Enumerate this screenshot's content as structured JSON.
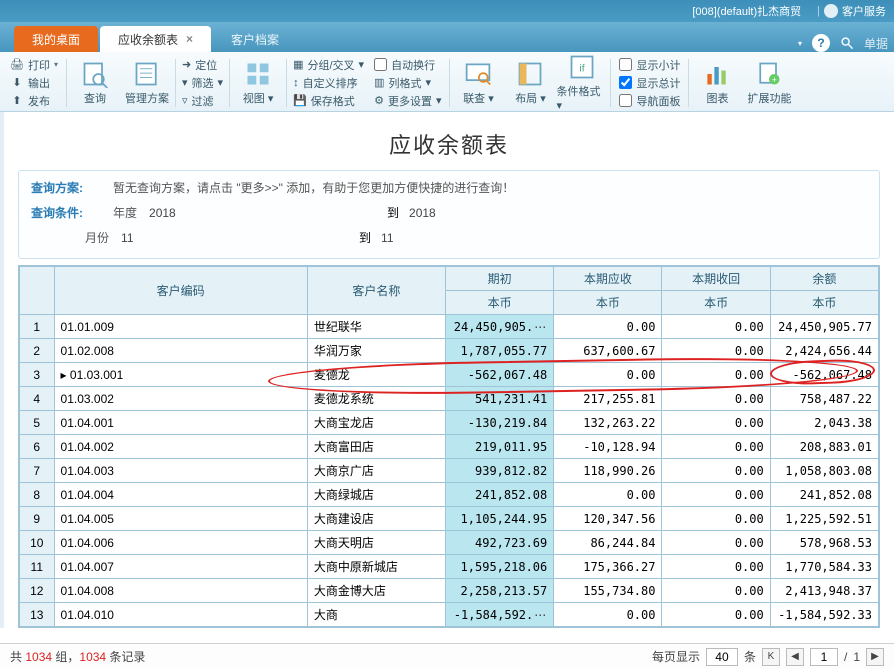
{
  "titlebar": {
    "db_info": "[008](default)扎杰商贸",
    "service_label": "客户服务"
  },
  "tabs": {
    "home": "我的桌面",
    "active": "应收余额表",
    "inactive": "客户档案",
    "search_placeholder": "单据"
  },
  "ribbon": {
    "print": "打印",
    "export": "输出",
    "publish": "发布",
    "query": "查询",
    "manage_plan": "管理方案",
    "locate": "定位",
    "filter": "筛选",
    "filter_clear": "过滤",
    "view": "视图",
    "group_cross": "分组/交叉",
    "custom_sort": "自定义排序",
    "save_layout": "保存格式",
    "auto_wrap": "自动换行",
    "col_format": "列格式",
    "more_settings": "更多设置",
    "lookup": "联查",
    "layout": "布局",
    "cond_fmt": "条件格式",
    "show_subtotal": "显示小计",
    "show_total": "显示总计",
    "nav_pane": "导航面板",
    "chart": "图表",
    "extend": "扩展功能"
  },
  "report": {
    "title": "应收余额表",
    "query_plan_label": "查询方案:",
    "query_plan_text": "暂无查询方案，请点击 \"更多>>\" 添加，有助于您更加方便快捷的进行查询！",
    "query_cond_label": "查询条件:",
    "year_label": "年度",
    "year_from": "2018",
    "to_label": "到",
    "year_to": "2018",
    "month_label": "月份",
    "month_from": "11",
    "month_to": "11"
  },
  "columns": {
    "code": "客户编码",
    "name": "客户名称",
    "qichu": "期初",
    "benqi_ys": "本期应收",
    "benqi_sh": "本期收回",
    "yue": "余额",
    "benbi": "本币"
  },
  "rows": [
    {
      "n": "1",
      "code": "01.01.009",
      "name": "世纪联华",
      "qichu": "24,450,905.",
      "qichu_ellipsis": "…",
      "ys": "0.00",
      "sh": "0.00",
      "yue": "24,450,905.77"
    },
    {
      "n": "2",
      "code": "01.02.008",
      "name": "华润万家",
      "qichu": "1,787,055.77",
      "ys": "637,600.67",
      "sh": "0.00",
      "yue": "2,424,656.44"
    },
    {
      "n": "3",
      "code": "01.03.001",
      "name": "麦德龙",
      "qichu": "-562,067.48",
      "ys": "0.00",
      "sh": "0.00",
      "yue": "-562,067.48",
      "pointer": true
    },
    {
      "n": "4",
      "code": "01.03.002",
      "name": "麦德龙系统",
      "qichu": "541,231.41",
      "ys": "217,255.81",
      "sh": "0.00",
      "yue": "758,487.22"
    },
    {
      "n": "5",
      "code": "01.04.001",
      "name": "大商宝龙店",
      "qichu": "-130,219.84",
      "ys": "132,263.22",
      "sh": "0.00",
      "yue": "2,043.38"
    },
    {
      "n": "6",
      "code": "01.04.002",
      "name": "大商富田店",
      "qichu": "219,011.95",
      "ys": "-10,128.94",
      "sh": "0.00",
      "yue": "208,883.01"
    },
    {
      "n": "7",
      "code": "01.04.003",
      "name": "大商京广店",
      "qichu": "939,812.82",
      "ys": "118,990.26",
      "sh": "0.00",
      "yue": "1,058,803.08"
    },
    {
      "n": "8",
      "code": "01.04.004",
      "name": "大商绿城店",
      "qichu": "241,852.08",
      "ys": "0.00",
      "sh": "0.00",
      "yue": "241,852.08"
    },
    {
      "n": "9",
      "code": "01.04.005",
      "name": "大商建设店",
      "qichu": "1,105,244.95",
      "ys": "120,347.56",
      "sh": "0.00",
      "yue": "1,225,592.51"
    },
    {
      "n": "10",
      "code": "01.04.006",
      "name": "大商天明店",
      "qichu": "492,723.69",
      "ys": "86,244.84",
      "sh": "0.00",
      "yue": "578,968.53"
    },
    {
      "n": "11",
      "code": "01.04.007",
      "name": "大商中原新城店",
      "qichu": "1,595,218.06",
      "ys": "175,366.27",
      "sh": "0.00",
      "yue": "1,770,584.33"
    },
    {
      "n": "12",
      "code": "01.04.008",
      "name": "大商金博大店",
      "qichu": "2,258,213.57",
      "ys": "155,734.80",
      "sh": "0.00",
      "yue": "2,413,948.37"
    },
    {
      "n": "13",
      "code": "01.04.010",
      "name": "大商",
      "qichu": "-1,584,592.",
      "qichu_ellipsis": "…",
      "ys": "0.00",
      "sh": "0.00",
      "yue": "-1,584,592.33"
    }
  ],
  "status": {
    "prefix": "共 ",
    "groups": "1034",
    "groups_suffix": " 组，",
    "records": "1034",
    "records_suffix": " 条记录",
    "page_display": "每页显示",
    "page_size": "40",
    "unit": "条",
    "page_cur": "1",
    "page_sep": "/",
    "page_total": "1"
  }
}
